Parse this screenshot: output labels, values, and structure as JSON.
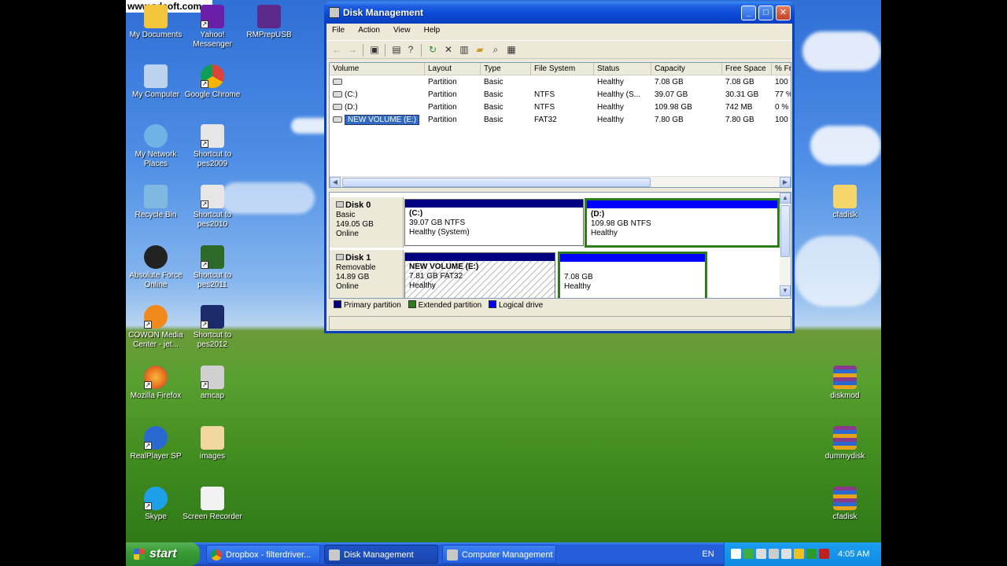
{
  "watermark": "www.zdsoft.com",
  "desktop_icons": [
    {
      "label": "My Documents",
      "icon": "my-documents-icon",
      "color": "#f3c53a"
    },
    {
      "label": "Yahoo! Messenger",
      "icon": "yahoo-messenger-icon",
      "color": "#6b1fa8"
    },
    {
      "label": "RMPrepUSB",
      "icon": "rmprepusb-icon",
      "color": "#5b2a8a"
    },
    {
      "label": "My Computer",
      "icon": "my-computer-icon",
      "color": "#bcd3f0"
    },
    {
      "label": "Google Chrome",
      "icon": "chrome-icon",
      "color": "#e0a22a"
    },
    {
      "label": "My Network Places",
      "icon": "network-places-icon",
      "color": "#6fb2e6"
    },
    {
      "label": "Shortcut to pes2009",
      "icon": "pes-shortcut-icon",
      "color": "#e6e6e6"
    },
    {
      "label": "Recycle Bin",
      "icon": "recycle-bin-icon",
      "color": "#7fb8e0"
    },
    {
      "label": "Shortcut to pes2010",
      "icon": "pes-shortcut-icon",
      "color": "#e6e6e6"
    },
    {
      "label": "Absolute Force Online",
      "icon": "afo-icon",
      "color": "#222222"
    },
    {
      "label": "Shortcut to pes2011",
      "icon": "pes-shortcut-icon",
      "color": "#2d6a2a"
    },
    {
      "label": "COWON Media Center - jet...",
      "icon": "cowon-icon",
      "color": "#f08a1a"
    },
    {
      "label": "Shortcut to pes2012",
      "icon": "pes-shortcut-icon",
      "color": "#1a2a6a"
    },
    {
      "label": "Mozilla Firefox",
      "icon": "firefox-icon",
      "color": "#e86a1a"
    },
    {
      "label": "amcap",
      "icon": "amcap-icon",
      "color": "#d0d0d0"
    },
    {
      "label": "RealPlayer SP",
      "icon": "realplayer-icon",
      "color": "#2a6ad0"
    },
    {
      "label": "images",
      "icon": "images-icon",
      "color": "#f0d8a0"
    },
    {
      "label": "Skype",
      "icon": "skype-icon",
      "color": "#1ea0e8"
    },
    {
      "label": "Screen Recorder",
      "icon": "screen-recorder-icon",
      "color": "#f2f2f2"
    },
    {
      "label": "cfadisk",
      "icon": "folder-icon",
      "color": "#f6d56a"
    },
    {
      "label": "diskmod",
      "icon": "winrar-icon",
      "color": "#8a3a8a"
    },
    {
      "label": "dummydisk",
      "icon": "winrar-icon",
      "color": "#8a3a8a"
    },
    {
      "label": "cfadisk",
      "icon": "winrar-icon",
      "color": "#8a3a8a"
    }
  ],
  "window": {
    "title": "Disk Management",
    "menu": [
      "File",
      "Action",
      "View",
      "Help"
    ],
    "toolbar_icons": [
      "back-arrow-icon",
      "forward-arrow-icon",
      "show-hide-tree-icon",
      "properties-icon",
      "help-icon",
      "refresh-icon",
      "delete-icon",
      "new-icon",
      "open-icon",
      "search-icon",
      "settings-icon"
    ],
    "list_columns": [
      "Volume",
      "Layout",
      "Type",
      "File System",
      "Status",
      "Capacity",
      "Free Space",
      "% Fr"
    ],
    "volumes": [
      {
        "volume": "",
        "layout": "Partition",
        "type": "Basic",
        "fs": "",
        "status": "Healthy",
        "capacity": "7.08 GB",
        "free": "7.08 GB",
        "pct": "100 %"
      },
      {
        "volume": "(C:)",
        "layout": "Partition",
        "type": "Basic",
        "fs": "NTFS",
        "status": "Healthy (S...",
        "capacity": "39.07 GB",
        "free": "30.31 GB",
        "pct": "77 %"
      },
      {
        "volume": "(D:)",
        "layout": "Partition",
        "type": "Basic",
        "fs": "NTFS",
        "status": "Healthy",
        "capacity": "109.98 GB",
        "free": "742 MB",
        "pct": "0 %"
      },
      {
        "volume": "NEW VOLUME (E:)",
        "layout": "Partition",
        "type": "Basic",
        "fs": "FAT32",
        "status": "Healthy",
        "capacity": "7.80 GB",
        "free": "7.80 GB",
        "pct": "100 %"
      }
    ],
    "disks": [
      {
        "name": "Disk 0",
        "kind": "Basic",
        "size": "149.05 GB",
        "state": "Online",
        "partitions": [
          {
            "title": "(C:)",
            "detail": "39.07 GB NTFS",
            "status": "Healthy (System)"
          },
          {
            "title": "(D:)",
            "detail": "109.98 GB NTFS",
            "status": "Healthy"
          }
        ]
      },
      {
        "name": "Disk 1",
        "kind": "Removable",
        "size": "14.89 GB",
        "state": "Online",
        "partitions": [
          {
            "title": "NEW VOLUME  (E:)",
            "detail": "7.81 GB FAT32",
            "status": "Healthy"
          },
          {
            "title": "",
            "detail": "7.08 GB",
            "status": "Healthy"
          }
        ]
      }
    ],
    "legend": [
      {
        "label": "Primary partition",
        "color": "#000080"
      },
      {
        "label": "Extended partition",
        "color": "#2b7d19"
      },
      {
        "label": "Logical drive",
        "color": "#0000ff"
      }
    ]
  },
  "taskbar": {
    "start_label": "start",
    "tasks": [
      {
        "label": "Dropbox - filterdriver...",
        "icon": "chrome-icon"
      },
      {
        "label": "Disk Management",
        "icon": "disk-management-icon"
      },
      {
        "label": "Computer Management",
        "icon": "computer-management-icon"
      }
    ],
    "language": "EN",
    "clock": "4:05 AM"
  }
}
